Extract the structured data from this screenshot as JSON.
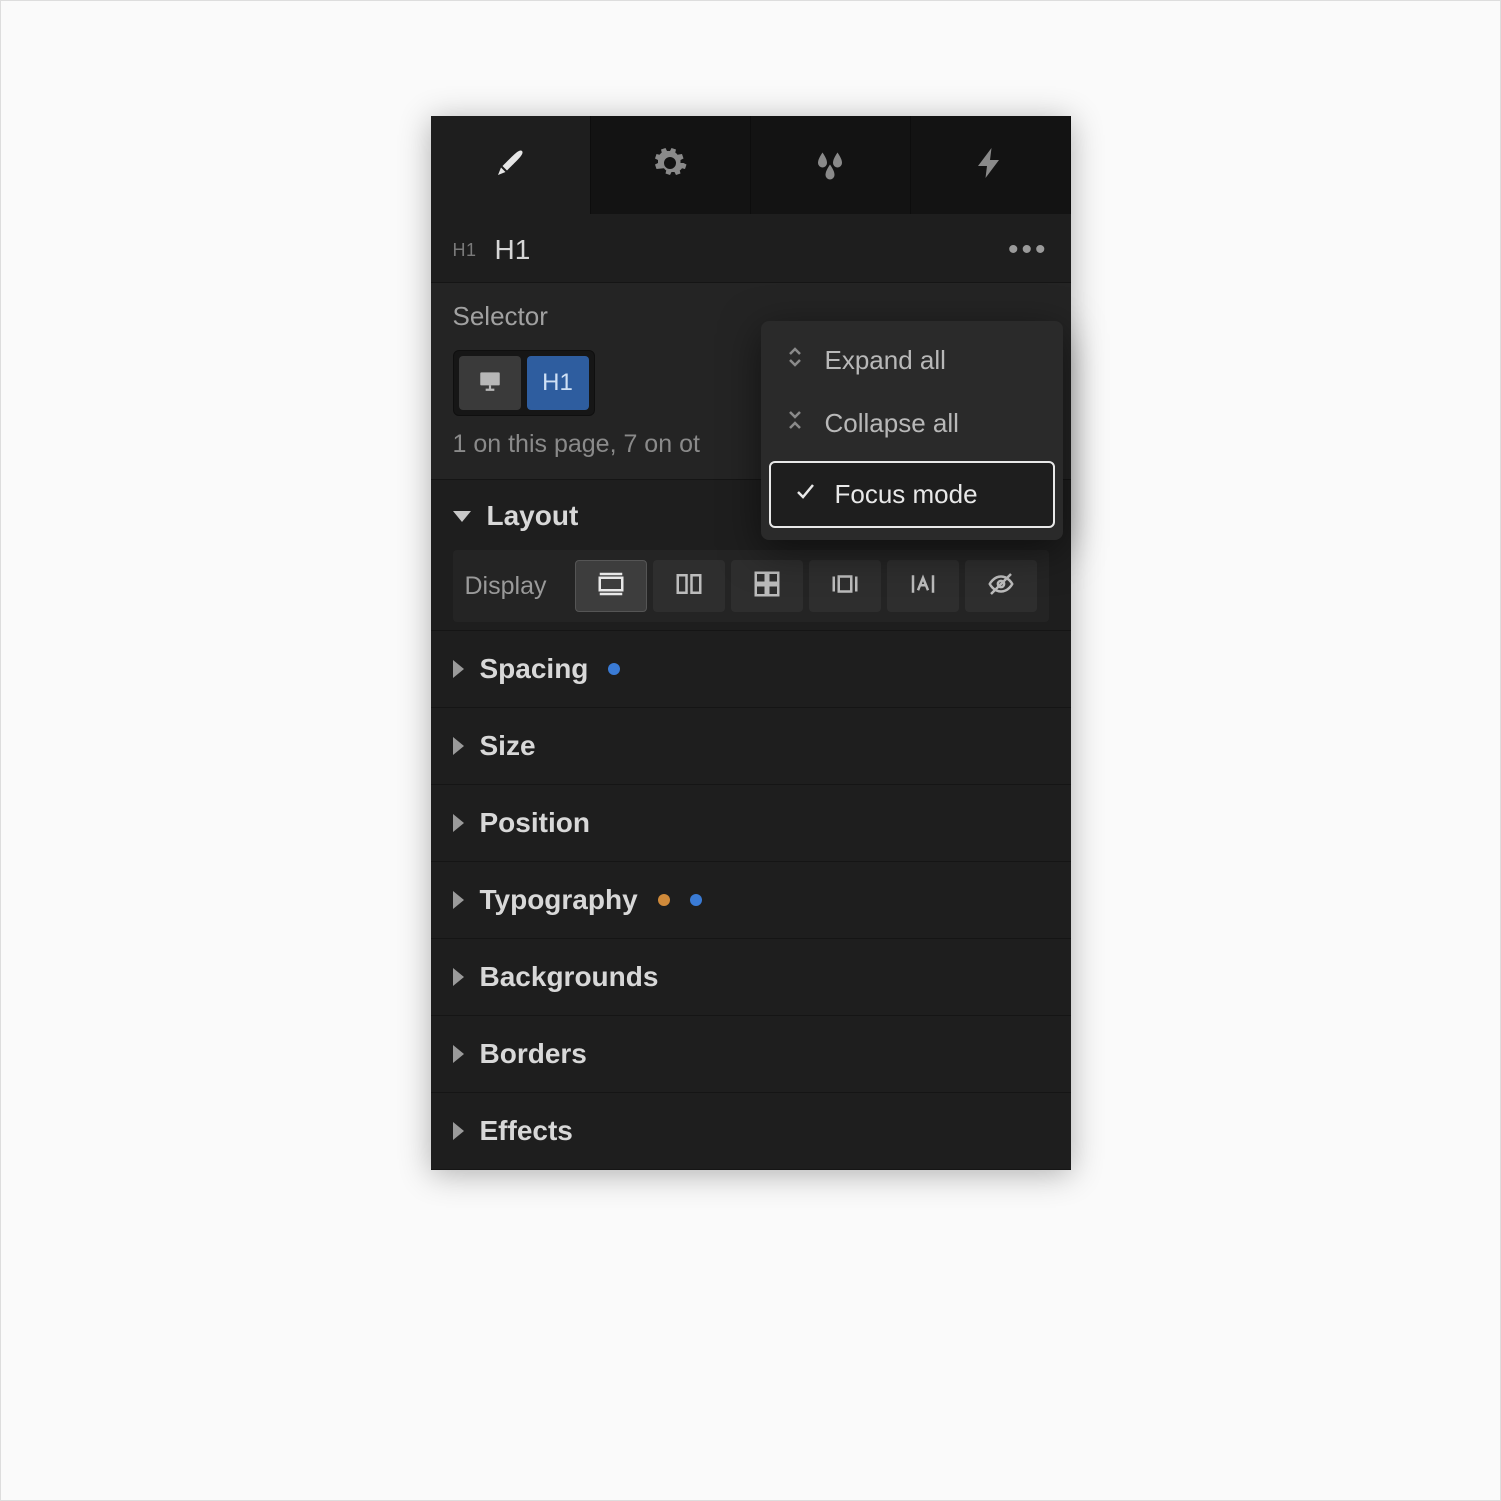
{
  "tabs": {
    "items": [
      "style",
      "settings",
      "effects",
      "interactions"
    ]
  },
  "element": {
    "tag": "H1",
    "label": "H1"
  },
  "selector": {
    "label": "Selector",
    "chip_tag": "H1",
    "note": "1 on this page, 7 on ot"
  },
  "popup": {
    "expand": "Expand all",
    "collapse": "Collapse all",
    "focus": "Focus mode"
  },
  "sections": {
    "layout": "Layout",
    "display_label": "Display",
    "spacing": "Spacing",
    "size": "Size",
    "position": "Position",
    "typography": "Typography",
    "backgrounds": "Backgrounds",
    "borders": "Borders",
    "effects": "Effects"
  }
}
